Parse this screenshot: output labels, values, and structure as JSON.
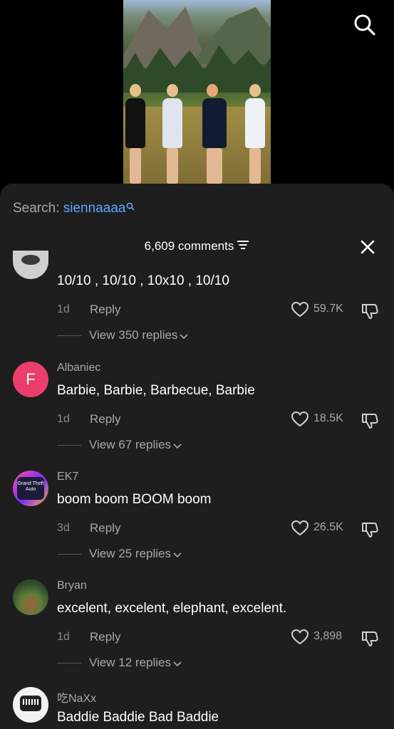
{
  "search": {
    "label": "Search:",
    "query": "siennaaaa"
  },
  "comments_header": {
    "count_label": "6,609 comments"
  },
  "comments": [
    {
      "username": "",
      "text": "10/10 , 10/10 , 10x10 , 10/10",
      "time": "1d",
      "reply_label": "Reply",
      "likes": "59.7K",
      "view_replies": "View 350 replies"
    },
    {
      "username": "Albaniec",
      "avatar_letter": "F",
      "text": "Barbie, Barbie, Barbecue, Barbie",
      "time": "1d",
      "reply_label": "Reply",
      "likes": "18.5K",
      "view_replies": "View 67 replies"
    },
    {
      "username": "EK7",
      "avatar_text": "Grand Theft Auto",
      "text": "boom boom BOOM boom",
      "time": "3d",
      "reply_label": "Reply",
      "likes": "26.5K",
      "view_replies": "View 25 replies"
    },
    {
      "username": "Bryan",
      "text": "excelent, excelent, elephant, excelent.",
      "time": "1d",
      "reply_label": "Reply",
      "likes": "3,898",
      "view_replies": "View 12 replies"
    },
    {
      "username": "吃NaXx",
      "text": "Baddie Baddie Bad Baddie"
    }
  ],
  "colors": {
    "accent": "#5ea7ff",
    "panel": "#1e1e1e",
    "avatar_pink": "#ec3e6a"
  }
}
